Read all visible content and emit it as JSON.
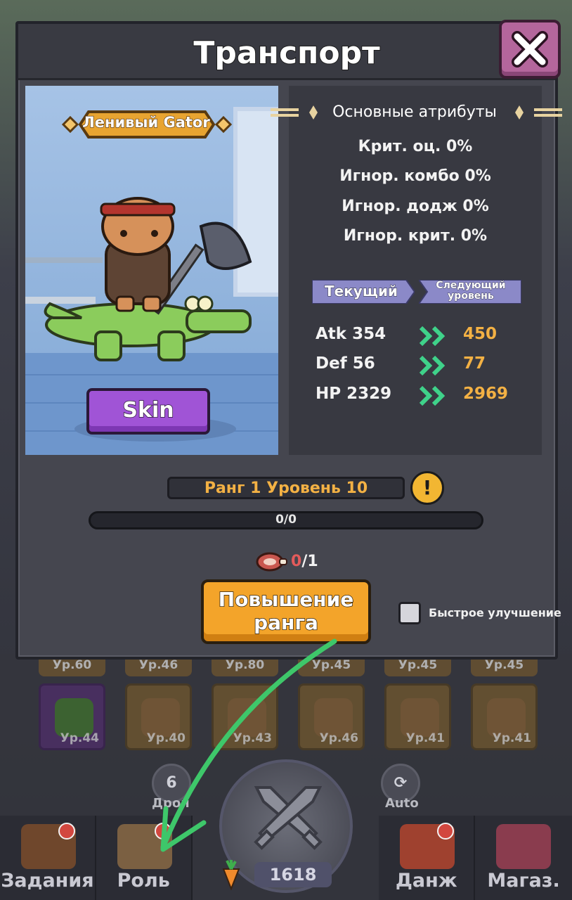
{
  "modal": {
    "title": "Транспорт",
    "character_name": "Ленивый Gator",
    "skin_label": "Skin",
    "attributes": {
      "header": "Основные атрибуты",
      "lines": [
        "Крит. оц. 0%",
        "Игнор. комбо 0%",
        "Игнор. додж 0%",
        "Игнор. крит. 0%"
      ]
    },
    "tabs": {
      "current": "Текущий",
      "next_line1": "Следующий",
      "next_line2": "уровень"
    },
    "stats": [
      {
        "current": "Atk 354",
        "next": "450"
      },
      {
        "current": "Def 56",
        "next": "77"
      },
      {
        "current": "HP 2329",
        "next": "2969"
      }
    ],
    "rank_level": "Ранг 1 Уровень 10",
    "progress_text": "0/0",
    "cost_have": "0",
    "cost_need": "/1",
    "rank_up_line1": "Повышение",
    "rank_up_line2": "ранга",
    "quick_upgrade_label": "Быстрое улучшение"
  },
  "background": {
    "top_levels": [
      "Ур.60",
      "Ур.46",
      "Ур.80",
      "Ур.45",
      "Ур.45",
      "Ур.45"
    ],
    "equipment_levels": [
      "Ур.44",
      "Ур.40",
      "Ур.43",
      "Ур.46",
      "Ур.41",
      "Ур.41"
    ],
    "drop_count": "6",
    "drop_label": "Дроп",
    "auto_label": "Auto",
    "carrot_count": "1618"
  },
  "bottom_nav": {
    "tasks": "Задания",
    "role": "Роль",
    "dungeon": "Данж",
    "shop": "Магаз."
  },
  "colors": {
    "accent_orange": "#f3a42a",
    "stat_next": "#f3b144",
    "skin_purple": "#a054d6",
    "close_pink": "#b4669c",
    "arrow_green": "#3ec76a"
  }
}
